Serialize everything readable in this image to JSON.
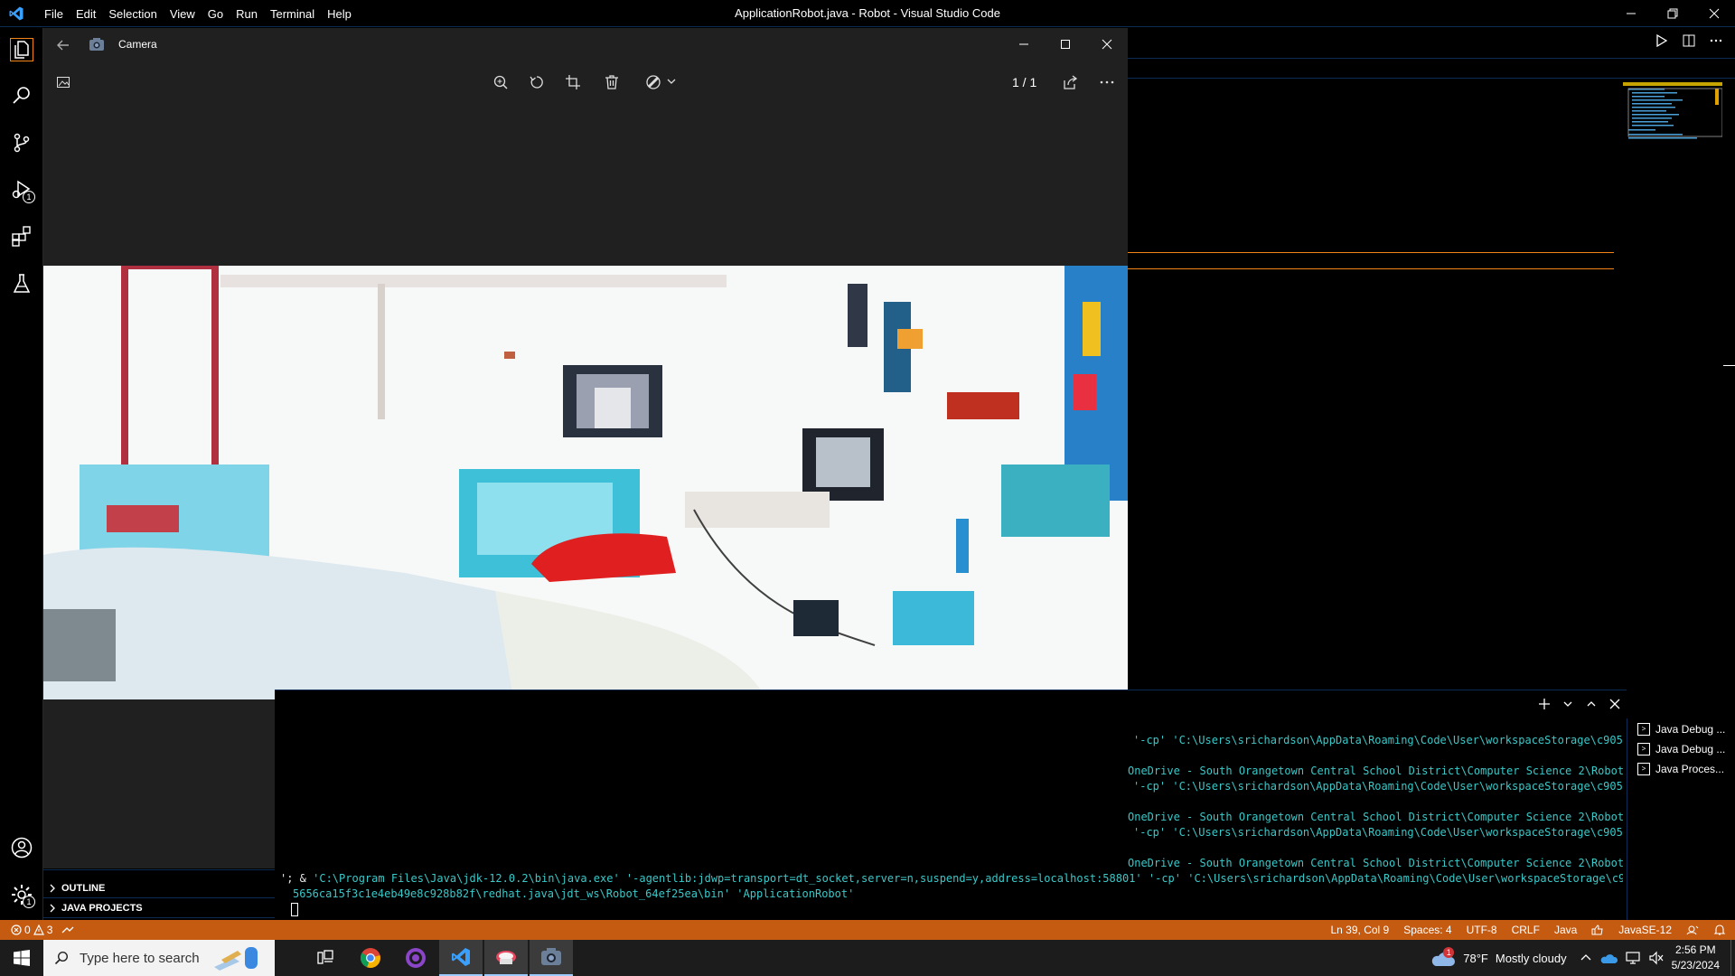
{
  "vscode": {
    "window_title": "ApplicationRobot.java - Robot - Visual Studio Code",
    "menu": [
      "File",
      "Edit",
      "Selection",
      "View",
      "Go",
      "Run",
      "Terminal",
      "Help"
    ],
    "activity_badges": {
      "run_debug": "1",
      "manage": "1"
    }
  },
  "camera": {
    "app_title": "Camera",
    "page_count": "1 / 1"
  },
  "side_panel": {
    "outline": "OUTLINE",
    "java_projects": "JAVA PROJECTS"
  },
  "terminal": {
    "lines": [
      "'-cp' 'C:\\Users\\srichardson\\AppData\\Roaming\\Code\\User\\workspaceStorage\\c905",
      "OneDrive - South Orangetown Central School District\\Computer Science 2\\Robot",
      "'-cp' 'C:\\Users\\srichardson\\AppData\\Roaming\\Code\\User\\workspaceStorage\\c905",
      "OneDrive - South Orangetown Central School District\\Computer Science 2\\Robot",
      "'-cp' 'C:\\Users\\srichardson\\AppData\\Roaming\\Code\\User\\workspaceStorage\\c905",
      "OneDrive - South Orangetown Central School District\\Computer Science 2\\Robot"
    ],
    "cmd_prefix": "'; & ",
    "cmd_line1": "'C:\\Program Files\\Java\\jdk-12.0.2\\bin\\java.exe' '-agentlib:jdwp=transport=dt_socket,server=n,suspend=y,address=localhost:58801' '-cp' 'C:\\Users\\srichardson\\AppData\\Roaming\\Code\\User\\workspaceStorage\\c905",
    "cmd_line2": "5656ca15f3c1e4eb49e8c928b82f\\redhat.java\\jdt_ws\\Robot_64ef25ea\\bin' 'ApplicationRobot'",
    "sessions": [
      "Java Debug ...",
      "Java Debug ...",
      "Java Proces..."
    ]
  },
  "statusbar": {
    "errors": "0",
    "warnings": "3",
    "position": "Ln 39, Col 9",
    "spaces": "Spaces: 4",
    "encoding": "UTF-8",
    "eol": "CRLF",
    "language": "Java",
    "jdk": "JavaSE-12"
  },
  "taskbar": {
    "search_placeholder": "Type here to search",
    "weather_temp": "78°F",
    "weather_desc": "Mostly cloudy",
    "weather_badge": "1",
    "time": "2:56 PM",
    "date": "5/23/2024"
  },
  "colors": {
    "statusbar": "#c55a11",
    "highcontrast_border": "#0c2b55",
    "terminal_cyan": "#3ac8c8",
    "accent_orange": "#f38518"
  }
}
